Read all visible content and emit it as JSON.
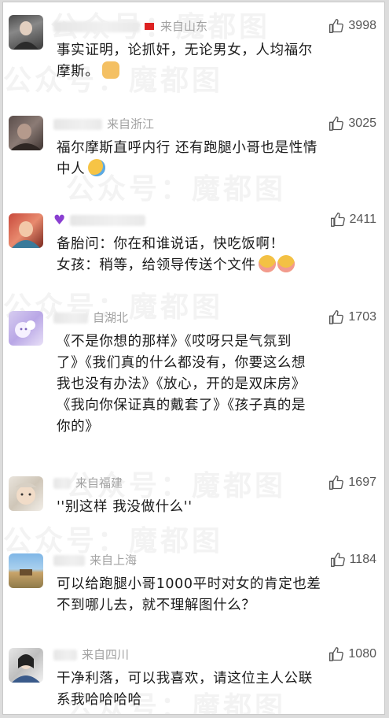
{
  "comments": [
    {
      "location": "来自山东",
      "likes": "3998",
      "text": "事实证明，论抓奸，无论男女，人均福尔\n摩斯。",
      "emoji": "cat-face-emoji"
    },
    {
      "location": "来自浙江",
      "likes": "3025",
      "text": "福尔摩斯直呼内行 还有跑腿小哥也是性情\n中人",
      "emoji": "laughing-crying-emoji"
    },
    {
      "location": "",
      "likes": "2411",
      "text": "备胎问：你在和谁说话，快吃饭啊！\n女孩：稍等，给领导传送个文件",
      "emoji": "shy-face-emoji",
      "prefix_icon": "purple-heart-icon"
    },
    {
      "location": "自湖北",
      "likes": "1703",
      "text": "《不是你想的那样》《哎呀只是气氛到\n了》《我们真的什么都没有，你要这么想\n我也没有办法》《放心，开的是双床房》\n《我向你保证真的戴套了》《孩子真的是\n你的》"
    },
    {
      "location": "来自福建",
      "likes": "1697",
      "text": "''别这样 我没做什么''"
    },
    {
      "location": "来自上海",
      "likes": "1184",
      "text": "可以给跑腿小哥1000平时对女的肯定也差\n不到哪儿去，就不理解图什么？"
    },
    {
      "location": "来自四川",
      "likes": "1080",
      "text": "干净利落，可以我喜欢，请这位主人公联\n系我哈哈哈哈"
    }
  ],
  "watermark": {
    "text_a": "公众号：",
    "text_b": "魔都图",
    "text_c": "公众号：魔都图"
  },
  "colors": {
    "like_icon": "#555555",
    "text": "#1a1a1a",
    "meta": "#9a9a9a"
  }
}
